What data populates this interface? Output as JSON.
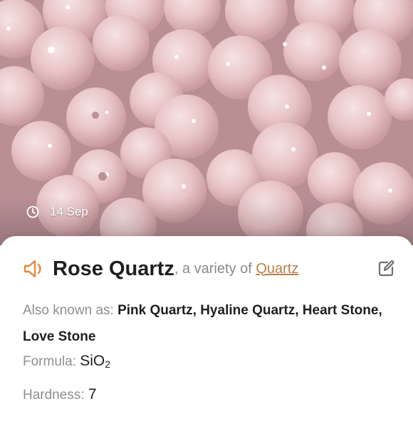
{
  "photo": {
    "date": "14 Sep",
    "clock_icon": "clock-icon"
  },
  "mineral": {
    "name": "Rose Quartz",
    "variety_prefix": ", a variety of ",
    "variety_link": "Quartz",
    "speaker_icon": "speaker-icon",
    "edit_icon": "edit-icon",
    "accent_color": "#e8873a",
    "link_color": "#b8804a"
  },
  "details": {
    "aka_label": "Also known as: ",
    "aka_value": "Pink Quartz, Hyaline Quartz, Heart Stone, Love Stone",
    "formula_label": "Formula: ",
    "formula_main": "SiO",
    "formula_sub": "2",
    "hardness_label": "Hardness: ",
    "hardness_value": "7"
  }
}
